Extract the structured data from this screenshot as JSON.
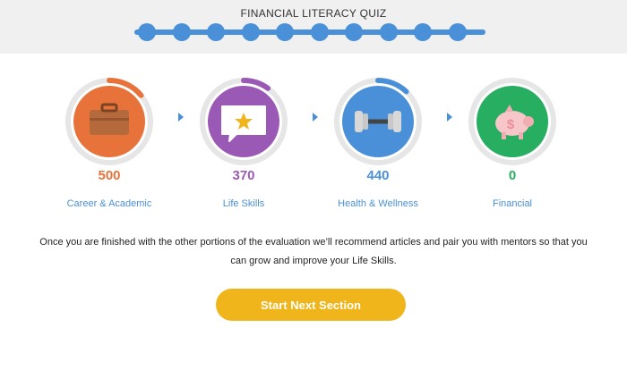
{
  "header": {
    "title": "FINANCIAL LITERACY QUIZ",
    "step_count": 10,
    "track_color": "#4a90d9"
  },
  "categories": [
    {
      "label": "Career & Academic",
      "score": "500",
      "color": "#e8733a",
      "progress": 0.14,
      "icon": "briefcase-icon"
    },
    {
      "label": "Life Skills",
      "score": "370",
      "color": "#9b59b6",
      "progress": 0.1,
      "icon": "speech-bubble-star-icon"
    },
    {
      "label": "Health & Wellness",
      "score": "440",
      "color": "#4a90d9",
      "progress": 0.12,
      "icon": "dumbbell-icon"
    },
    {
      "label": "Financial",
      "score": "0",
      "color": "#27ae60",
      "progress": 0,
      "icon": "piggy-bank-icon"
    }
  ],
  "message": "Once you are finished with the other portions of the evaluation we’ll recommend articles and pair you with mentors so that you can grow and improve your Life Skills.",
  "cta": {
    "label": "Start Next Section",
    "color": "#f0b51a"
  },
  "arrow_color": "#4a90d9"
}
